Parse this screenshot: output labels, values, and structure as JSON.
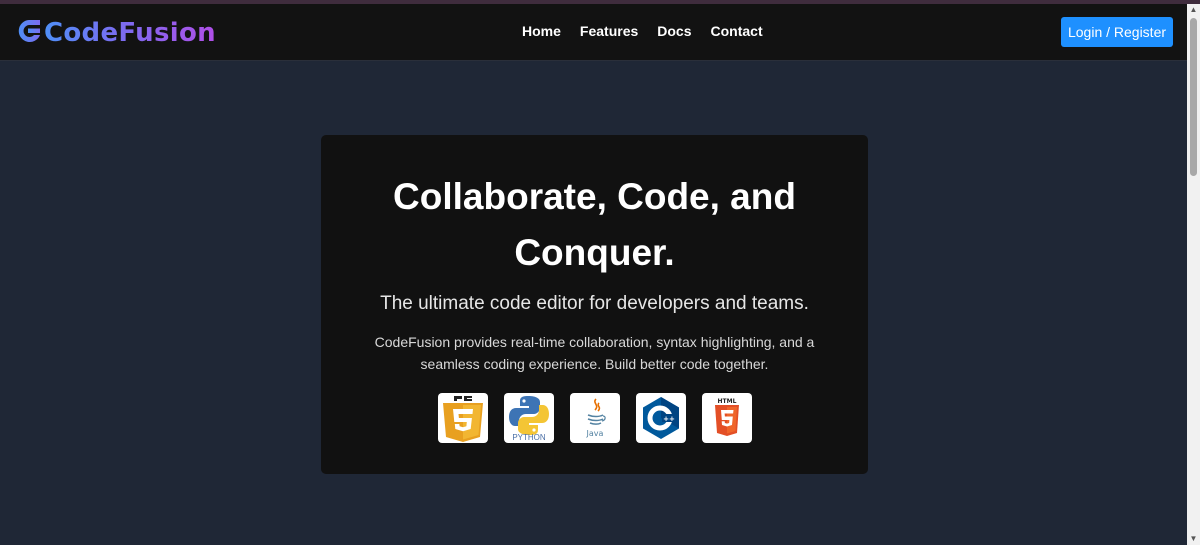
{
  "brand": {
    "name": "CodeFusion"
  },
  "nav": {
    "links": [
      {
        "label": "Home"
      },
      {
        "label": "Features"
      },
      {
        "label": "Docs"
      },
      {
        "label": "Contact"
      }
    ],
    "login_label": "Login / Register"
  },
  "hero": {
    "title": "Collaborate, Code, and Conquer.",
    "subtitle": "The ultimate code editor for developers and teams.",
    "description": "CodeFusion provides real-time collaboration, syntax highlighting, and a seamless coding experience. Build better code together.",
    "languages": [
      {
        "icon": "javascript-icon"
      },
      {
        "icon": "python-icon",
        "label": "PYTHON"
      },
      {
        "icon": "java-icon",
        "label": "Java"
      },
      {
        "icon": "cpp-icon"
      },
      {
        "icon": "html5-icon",
        "label": "HTML"
      }
    ]
  },
  "colors": {
    "accent": "#1e90ff",
    "navbar_bg": "#121212",
    "page_bg": "#1f2736",
    "card_bg": "#111111"
  }
}
